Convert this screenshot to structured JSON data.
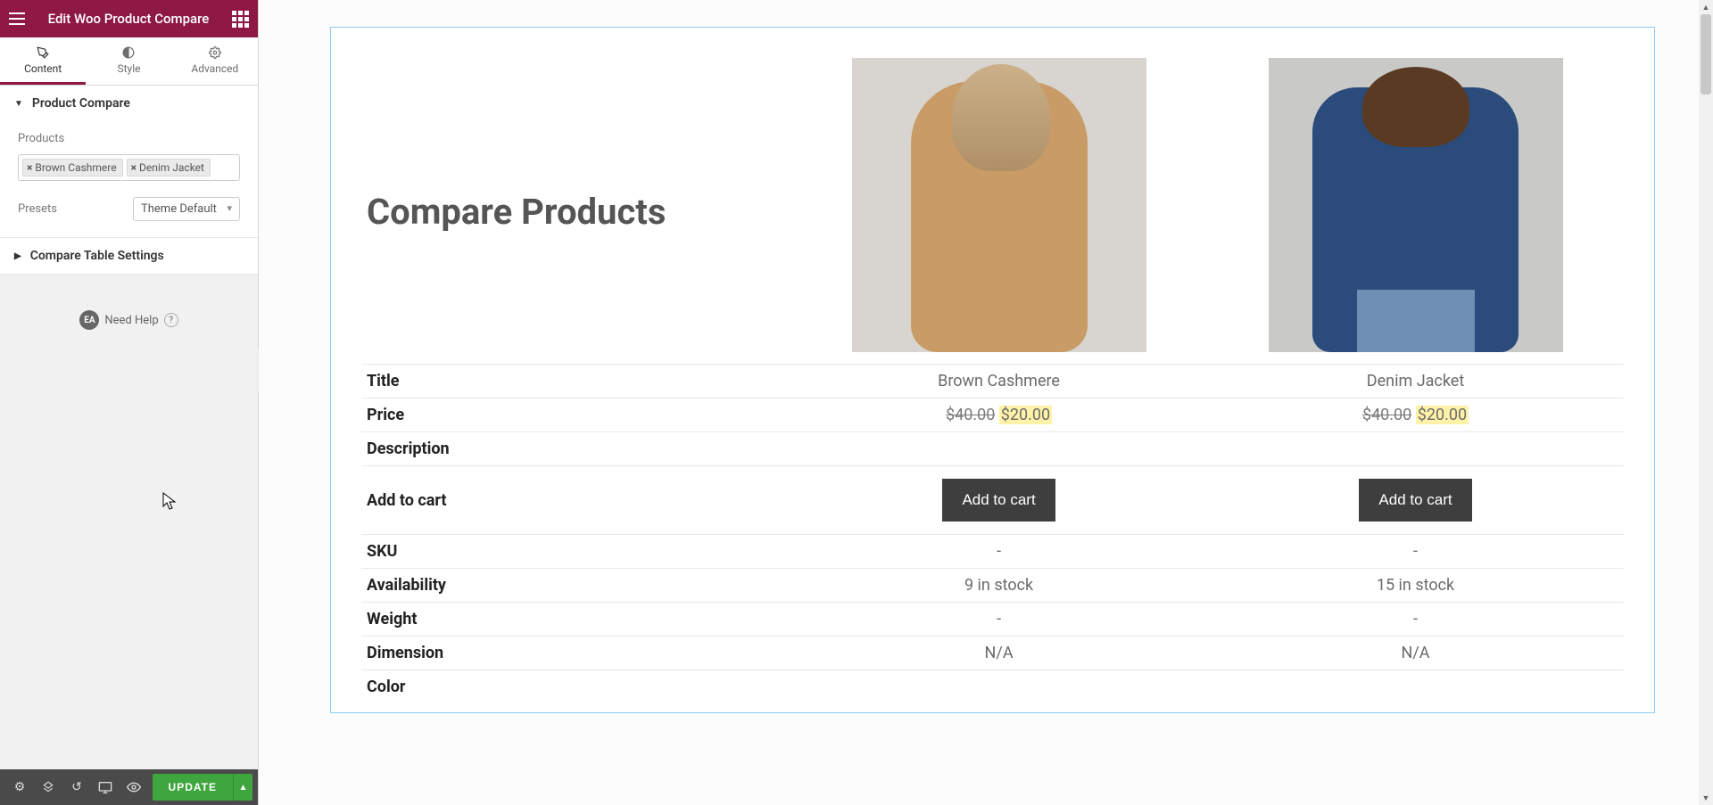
{
  "header": {
    "title": "Edit Woo Product Compare"
  },
  "tabs": {
    "content": "Content",
    "style": "Style",
    "advanced": "Advanced"
  },
  "sections": {
    "productCompare": {
      "title": "Product Compare",
      "productsLabel": "Products",
      "tags": [
        "Brown Cashmere",
        "Denim Jacket"
      ],
      "presetsLabel": "Presets",
      "presetsValue": "Theme Default"
    },
    "tableSettings": {
      "title": "Compare Table Settings"
    }
  },
  "help": {
    "badge": "EA",
    "text": "Need Help",
    "q": "?"
  },
  "footer": {
    "update": "UPDATE"
  },
  "compare": {
    "heading": "Compare Products",
    "rows": {
      "title": "Title",
      "price": "Price",
      "description": "Description",
      "addToCart": "Add to cart",
      "sku": "SKU",
      "availability": "Availability",
      "weight": "Weight",
      "dimension": "Dimension",
      "color": "Color"
    },
    "products": [
      {
        "title": "Brown Cashmere",
        "oldPrice": "$40.00",
        "newPrice": "$20.00",
        "cartLabel": "Add to cart",
        "sku": "-",
        "availability": "9 in stock",
        "weight": "-",
        "dimension": "N/A"
      },
      {
        "title": "Denim Jacket",
        "oldPrice": "$40.00",
        "newPrice": "$20.00",
        "cartLabel": "Add to cart",
        "sku": "-",
        "availability": "15 in stock",
        "weight": "-",
        "dimension": "N/A"
      }
    ]
  }
}
